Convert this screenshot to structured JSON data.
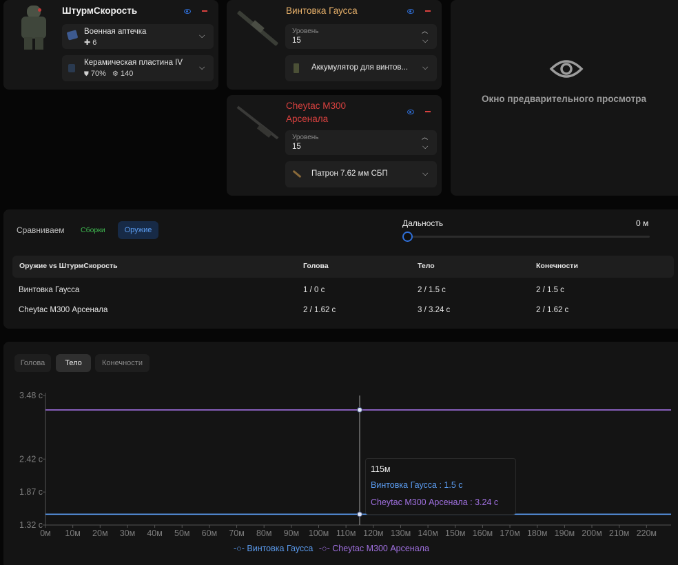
{
  "build": {
    "name": "ШтурмСкорость",
    "medkit": {
      "label": "Военная аптечка",
      "count": "6"
    },
    "plate": {
      "label": "Керамическая пластина IV",
      "armor": "70%",
      "durability": "140"
    }
  },
  "weapon1": {
    "name": "Винтовка Гаусса",
    "name_color": "#e9b26b",
    "level_label": "Уровень",
    "level_value": "15",
    "ammo": "Аккумулятор для винтов..."
  },
  "weapon2": {
    "name_line1": "Cheytac M300",
    "name_line2": "Арсенала",
    "name_color": "#d9413f",
    "level_label": "Уровень",
    "level_value": "15",
    "ammo": "Патрон 7.62 мм СБП"
  },
  "preview": {
    "text": "Окно предварительного просмотра"
  },
  "compare": {
    "label": "Сравниваем",
    "tab_builds": "Сборки",
    "tab_weapons": "Оружие",
    "distance_label": "Дальность",
    "distance_value": "0 м",
    "distance_fraction": 0
  },
  "table": {
    "headers": [
      "Оружие vs ШтурмСкорость",
      "Голова",
      "Тело",
      "Конечности"
    ],
    "rows": [
      [
        "Винтовка Гаусса",
        "1 / 0 с",
        "2 / 1.5 с",
        "2 / 1.5 с"
      ],
      [
        "Cheytac M300 Арсенала",
        "2 / 1.62 с",
        "3 / 3.24 с",
        "2 / 1.62 с"
      ]
    ]
  },
  "chart_tabs": [
    "Голова",
    "Тело",
    "Конечности"
  ],
  "chart_tab_active": "Тело",
  "tooltip": {
    "title": "115м",
    "line1": "Винтовка Гаусса : 1.5 с",
    "line2": "Cheytac M300 Арсенала : 3.24 с"
  },
  "colors": {
    "blue": "#5b9cf0",
    "purple": "#a070e0",
    "accent": "#2f6fd8",
    "red": "#d9413f",
    "green": "#3fb950"
  },
  "chart_data": {
    "type": "line",
    "x": [
      0,
      115,
      229
    ],
    "x_ticks": [
      "0м",
      "10м",
      "20м",
      "30м",
      "40м",
      "50м",
      "60м",
      "70м",
      "80м",
      "90м",
      "100м",
      "110м",
      "120м",
      "130м",
      "140м",
      "150м",
      "160м",
      "170м",
      "180м",
      "190м",
      "200м",
      "210м",
      "220м"
    ],
    "y_ticks": [
      "3.48 с",
      "2.42 с",
      "1.87 с",
      "1.32 с"
    ],
    "ylim": [
      1.32,
      3.48
    ],
    "series": [
      {
        "name": "Винтовка Гаусса",
        "values": [
          1.5,
          1.5,
          1.5
        ],
        "color": "#5b9cf0"
      },
      {
        "name": "Cheytac M300 Арсенала",
        "values": [
          3.24,
          3.24,
          3.24
        ],
        "color": "#a070e0"
      }
    ],
    "legend_position": "bottom",
    "crosshair_x": 115
  }
}
